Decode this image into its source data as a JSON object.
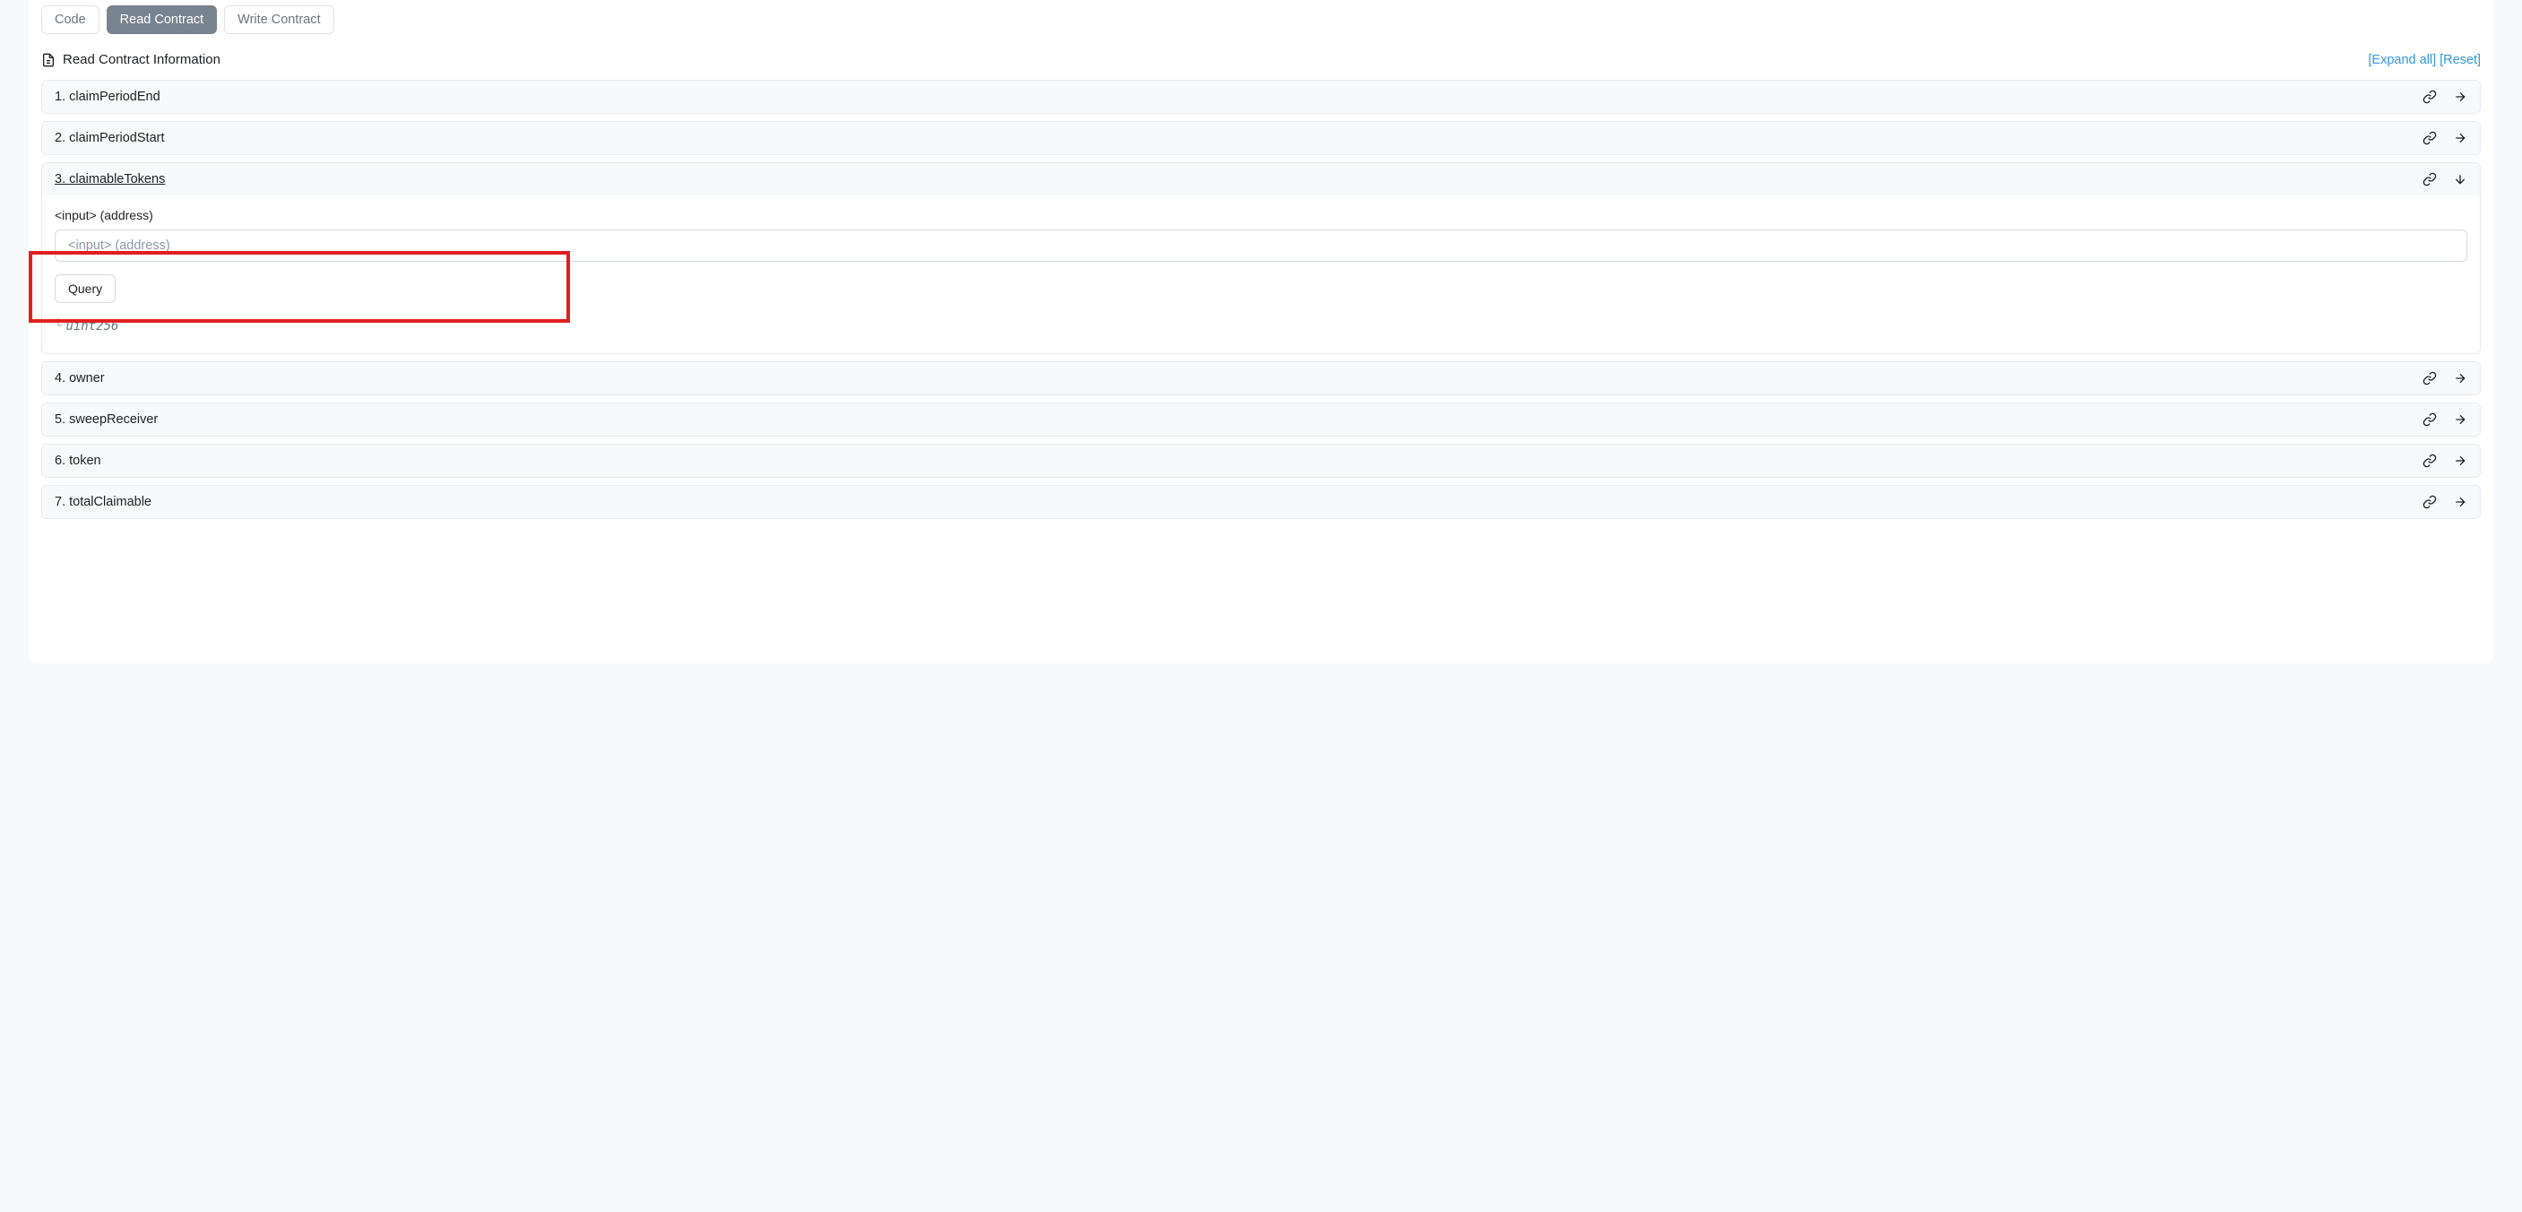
{
  "tabs": {
    "code": "Code",
    "read": "Read Contract",
    "write": "Write Contract"
  },
  "header": {
    "title": "Read Contract Information",
    "expand": "[Expand all]",
    "reset": "[Reset]"
  },
  "functions": [
    {
      "num": "1.",
      "name": "claimPeriodEnd",
      "expanded": false
    },
    {
      "num": "2.",
      "name": "claimPeriodStart",
      "expanded": false
    },
    {
      "num": "3.",
      "name": "claimableTokens",
      "expanded": true,
      "input_label": "<input> (address)",
      "input_placeholder": "<input> (address)",
      "query_label": "Query",
      "return_type": "uint256"
    },
    {
      "num": "4.",
      "name": "owner",
      "expanded": false
    },
    {
      "num": "5.",
      "name": "sweepReceiver",
      "expanded": false
    },
    {
      "num": "6.",
      "name": "token",
      "expanded": false
    },
    {
      "num": "7.",
      "name": "totalClaimable",
      "expanded": false
    }
  ]
}
